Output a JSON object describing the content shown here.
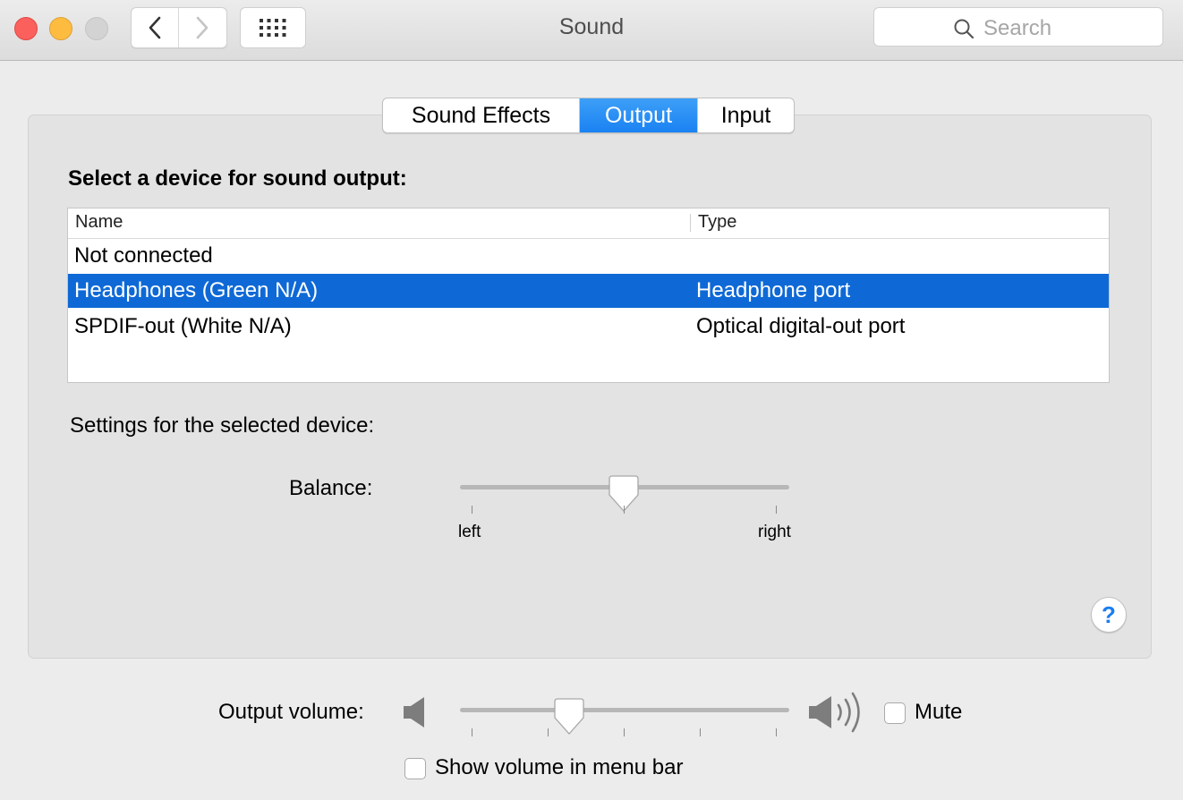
{
  "window": {
    "title": "Sound",
    "search_placeholder": "Search"
  },
  "tabs": [
    {
      "label": "Sound Effects",
      "selected": false
    },
    {
      "label": "Output",
      "selected": true
    },
    {
      "label": "Input",
      "selected": false
    }
  ],
  "output": {
    "heading": "Select a device for sound output:",
    "columns": {
      "name": "Name",
      "type": "Type"
    },
    "devices": [
      {
        "name": "Not connected",
        "type": ""
      },
      {
        "name": "Headphones (Green N/A)",
        "type": "Headphone port",
        "selected": true
      },
      {
        "name": "SPDIF-out (White N/A)",
        "type": "Optical digital-out port"
      }
    ],
    "settings_heading": "Settings for the selected device:",
    "balance": {
      "label": "Balance:",
      "left_label": "left",
      "right_label": "right",
      "value": 0.5
    }
  },
  "volume": {
    "label": "Output volume:",
    "value": 0.32,
    "mute_label": "Mute",
    "mute_checked": false,
    "menu_bar_label": "Show volume in menu bar",
    "menu_bar_checked": false
  },
  "help_label": "?",
  "colors": {
    "accent": "#1a82f2",
    "selection": "#0e69d6"
  },
  "icons": {
    "back": "chevron-left-icon",
    "forward": "chevron-right-icon",
    "grid": "grid-icon",
    "search": "search-icon",
    "volume_low": "speaker-low-icon",
    "volume_high": "speaker-high-icon"
  }
}
